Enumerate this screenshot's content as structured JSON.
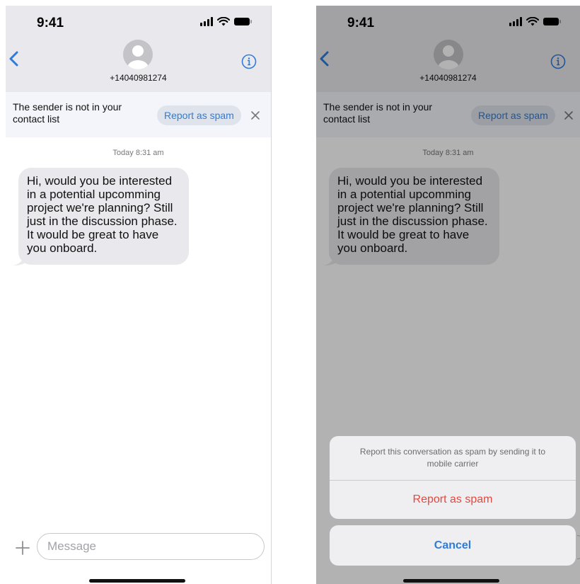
{
  "status": {
    "time": "9:41"
  },
  "contact": {
    "number": "+14040981274"
  },
  "banner": {
    "text": "The sender is not in your contact list",
    "report_label": "Report as spam"
  },
  "thread": {
    "timestamp": "Today 8:31 am",
    "messages": [
      {
        "text": "Hi, would you be interested in a potential upcomming project we're planning? Still just in the discussion phase. It would be great to have you onboard."
      }
    ]
  },
  "composer": {
    "placeholder": "Message"
  },
  "action_sheet": {
    "message": "Report this conversation as spam by sending it to mobile carrier",
    "report_label": "Report as spam",
    "cancel_label": "Cancel"
  },
  "colors": {
    "accent_blue": "#2f7bd9",
    "destructive_red": "#e8463c",
    "bubble_gray": "#e9e9ed",
    "header_gray": "#e9e9ed"
  },
  "icons": [
    "chevron-left-icon",
    "info-icon",
    "avatar-icon",
    "close-icon",
    "plus-icon",
    "signal-icon",
    "wifi-icon",
    "battery-icon"
  ]
}
